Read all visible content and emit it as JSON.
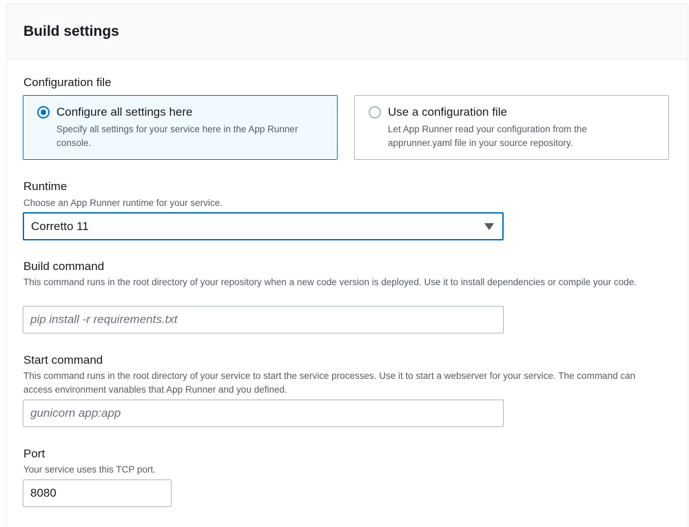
{
  "panel": {
    "title": "Build settings"
  },
  "configuration_file": {
    "label": "Configuration file",
    "options": [
      {
        "title": "Configure all settings here",
        "description": "Specify all settings for your service here in the App Runner console.",
        "selected": true
      },
      {
        "title": "Use a configuration file",
        "description": "Let App Runner read your configuration from the apprunner.yaml file in your source repository.",
        "selected": false
      }
    ]
  },
  "runtime": {
    "label": "Runtime",
    "description": "Choose an App Runner runtime for your service.",
    "selected_value": "Corretto 11"
  },
  "build_command": {
    "label": "Build command",
    "description": "This command runs in the root directory of your repository when a new code version is deployed. Use it to install dependencies or compile your code.",
    "value": "",
    "placeholder": "pip install -r requirements.txt"
  },
  "start_command": {
    "label": "Start command",
    "description": "This command runs in the root directory of your service to start the service processes. Use it to start a webserver for your service. The command can access environment variables that App Runner and you defined.",
    "value": "",
    "placeholder": "gunicorn app:app"
  },
  "port": {
    "label": "Port",
    "description": "Your service uses this TCP port.",
    "value": "8080"
  },
  "colors": {
    "accent": "#0073bb",
    "selected_tile_bg": "#f1faff",
    "border": "#aab7b8",
    "secondary_text": "#545b64"
  },
  "icons": {
    "runtime_dropdown": "caret-down-icon"
  }
}
